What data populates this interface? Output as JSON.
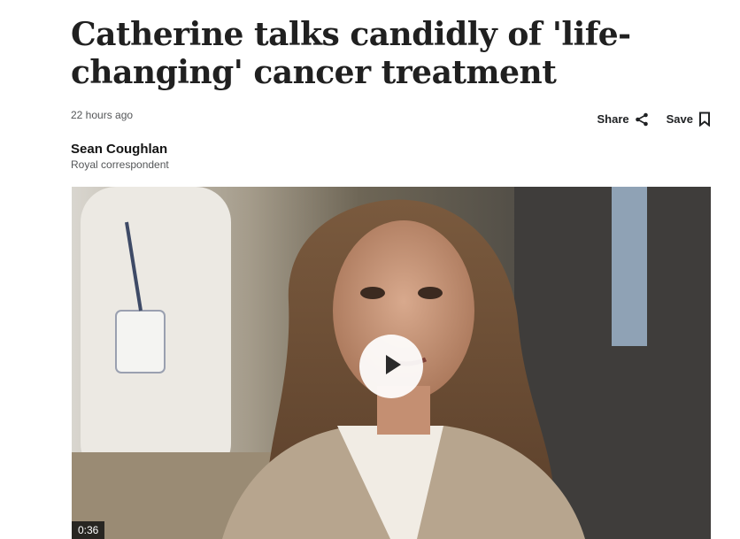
{
  "article": {
    "headline": "Catherine talks candidly of 'life-changing' cancer treatment",
    "timestamp": "22 hours ago",
    "author": "Sean Coughlan",
    "author_role": "Royal correspondent"
  },
  "actions": {
    "share_label": "Share",
    "save_label": "Save",
    "share_icon": "share-icon",
    "save_icon": "bookmark-icon"
  },
  "video": {
    "duration": "0:36",
    "play_icon": "play-icon"
  }
}
